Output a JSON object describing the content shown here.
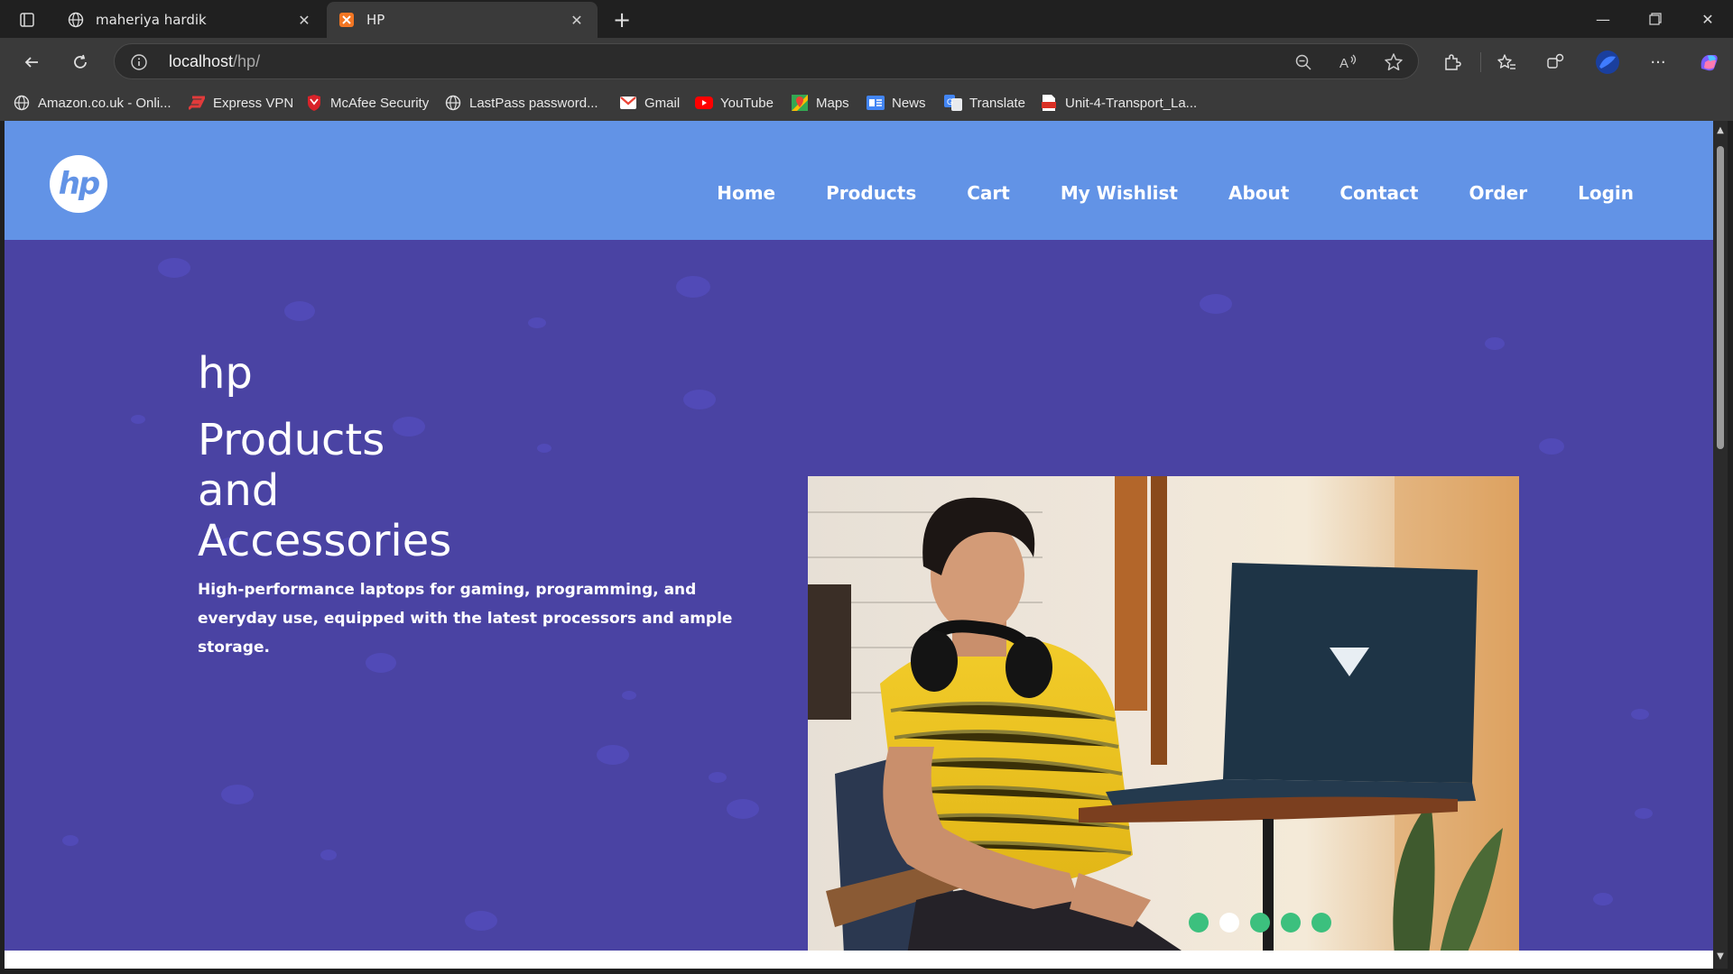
{
  "browser": {
    "tabs": [
      {
        "title": "maheriya hardik",
        "icon": "globe-icon"
      },
      {
        "title": "HP",
        "icon": "xampp-icon"
      }
    ],
    "address": {
      "host": "localhost",
      "path": "/hp/"
    },
    "bookmarks": [
      {
        "label": "Amazon.co.uk - Onli...",
        "icon": "globe-icon"
      },
      {
        "label": "Express VPN",
        "icon": "expressvpn-icon"
      },
      {
        "label": "McAfee Security",
        "icon": "mcafee-icon"
      },
      {
        "label": "LastPass password...",
        "icon": "globe-icon"
      },
      {
        "label": "Gmail",
        "icon": "gmail-icon"
      },
      {
        "label": "YouTube",
        "icon": "youtube-icon"
      },
      {
        "label": "Maps",
        "icon": "maps-icon"
      },
      {
        "label": "News",
        "icon": "news-icon"
      },
      {
        "label": "Translate",
        "icon": "translate-icon"
      },
      {
        "label": "Unit-4-Transport_La...",
        "icon": "pdf-icon"
      }
    ]
  },
  "site": {
    "logo_text": "hp",
    "nav": [
      "Home",
      "Products",
      "Cart",
      "My Wishlist",
      "About",
      "Contact",
      "Order",
      "Login"
    ],
    "hero": {
      "brand": "hp",
      "heading_lines": [
        "Products",
        "and",
        "Accessories"
      ],
      "description": "High-performance laptops for gaming, programming, and everyday use, equipped with the latest processors and ample storage."
    },
    "slider": {
      "slide_count": 5,
      "active_index": 1
    }
  },
  "colors": {
    "nav_bg": "#6293e6",
    "hero_bg": "#4a43a3",
    "pager_dot": "#3cc07e",
    "pager_active": "#ffffff"
  }
}
